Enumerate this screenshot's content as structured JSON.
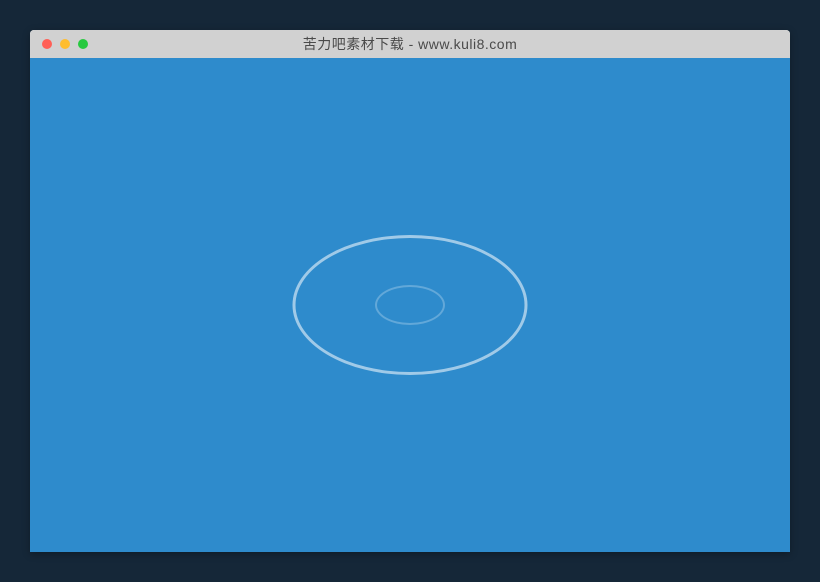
{
  "window": {
    "title": "苦力吧素材下载 - www.kuli8.com"
  }
}
